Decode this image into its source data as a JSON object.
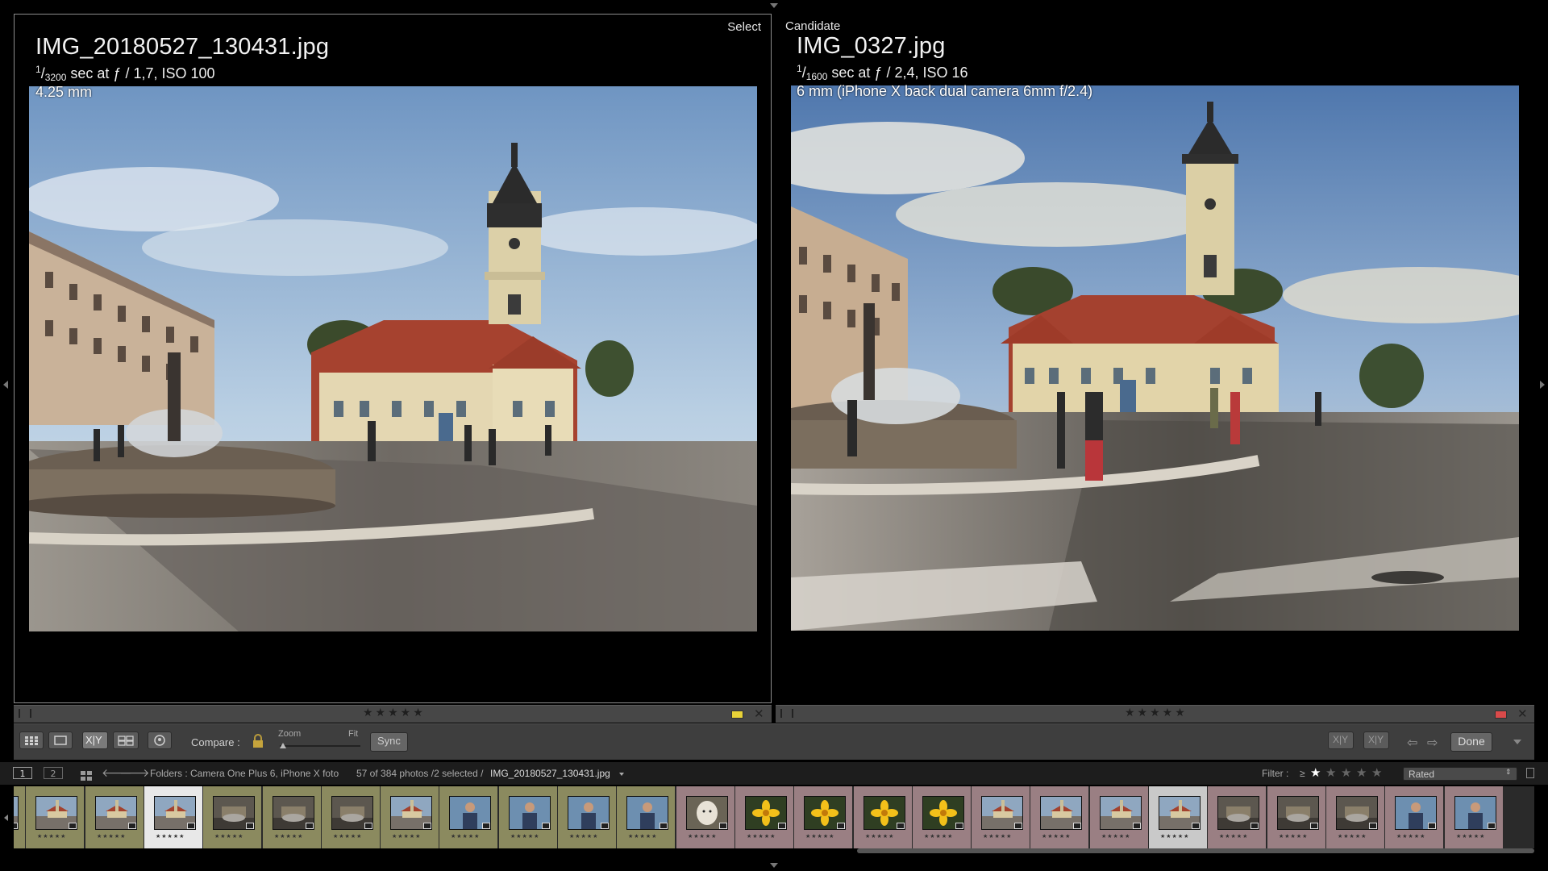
{
  "left_pane": {
    "label": "Select",
    "file_name": "IMG_20180527_130431.jpg",
    "shutter_num": "1",
    "shutter_den": "3200",
    "exif_rest": " sec at ƒ / 1,7, ISO 100",
    "lens": "4.25 mm",
    "stars": "★★★★★",
    "color_label": "#e8d238"
  },
  "right_pane": {
    "label": "Candidate",
    "file_name": "IMG_0327.jpg",
    "shutter_num": "1",
    "shutter_den": "1600",
    "exif_rest": " sec at ƒ / 2,4, ISO 16",
    "lens": "6 mm (iPhone X back dual camera 6mm f/2.4)",
    "stars": "★★★★★",
    "color_label": "#d94a4a"
  },
  "toolbar": {
    "compare_label": "Compare :",
    "zoom_label": "Zoom",
    "fit_label": "Fit",
    "sync_label": "Sync",
    "xy_label": "X|Y",
    "done_label": "Done"
  },
  "filmstrip_header": {
    "page1": "1",
    "page2": "2",
    "source": "Folders : Camera One Plus 6, iPhone X foto",
    "count": "57 of 384 photos /2 selected /",
    "selected_file": "IMG_20180527_130431.jpg",
    "filter_label": "Filter :",
    "filter_op": "≥",
    "filter_preset": "Rated"
  },
  "filmstrip": {
    "thumb_stars": "★★★★★",
    "cells": [
      {
        "type": "plaza",
        "tint": "#8b8a5f"
      },
      {
        "type": "plaza",
        "tint": "#8b8a5f"
      },
      {
        "type": "plaza",
        "tint": "#8b8a5f"
      },
      {
        "type": "plaza",
        "tint": "#e8e8e8",
        "selected": true
      },
      {
        "type": "dark",
        "tint": "#8b8a5f"
      },
      {
        "type": "dark",
        "tint": "#8b8a5f"
      },
      {
        "type": "dark",
        "tint": "#8b8a5f"
      },
      {
        "type": "plaza",
        "tint": "#8b8a5f"
      },
      {
        "type": "person",
        "tint": "#8b8a5f"
      },
      {
        "type": "person",
        "tint": "#8b8a5f"
      },
      {
        "type": "person",
        "tint": "#8b8a5f"
      },
      {
        "type": "person",
        "tint": "#8b8a5f"
      },
      {
        "type": "dog",
        "tint": "#9a7f83"
      },
      {
        "type": "flower",
        "tint": "#9a7f83"
      },
      {
        "type": "flower",
        "tint": "#9a7f83"
      },
      {
        "type": "flower",
        "tint": "#9a7f83"
      },
      {
        "type": "flower",
        "tint": "#9a7f83"
      },
      {
        "type": "plaza",
        "tint": "#9a7f83"
      },
      {
        "type": "plaza",
        "tint": "#9a7f83"
      },
      {
        "type": "plaza",
        "tint": "#9a7f83"
      },
      {
        "type": "plaza",
        "tint": "#c9c9c9",
        "selected": true
      },
      {
        "type": "dark",
        "tint": "#9a7f83"
      },
      {
        "type": "dark",
        "tint": "#9a7f83"
      },
      {
        "type": "dark",
        "tint": "#9a7f83"
      },
      {
        "type": "person",
        "tint": "#9a7f83"
      },
      {
        "type": "person",
        "tint": "#9a7f83"
      }
    ]
  }
}
